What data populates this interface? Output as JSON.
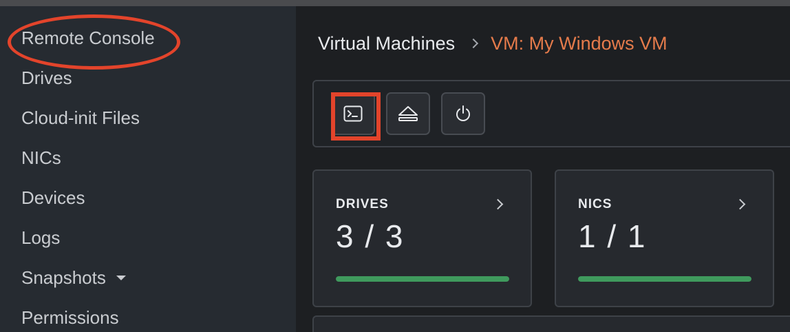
{
  "sidebar": {
    "items": [
      {
        "label": "Remote Console"
      },
      {
        "label": "Drives"
      },
      {
        "label": "Cloud-init Files"
      },
      {
        "label": "NICs"
      },
      {
        "label": "Devices"
      },
      {
        "label": "Logs"
      },
      {
        "label": "Snapshots"
      },
      {
        "label": "Permissions"
      }
    ]
  },
  "breadcrumb": {
    "root": "Virtual Machines",
    "current": "VM: My Windows VM"
  },
  "toolbar": {
    "buttons": [
      {
        "icon": "terminal-icon"
      },
      {
        "icon": "eject-icon"
      },
      {
        "icon": "power-icon"
      }
    ]
  },
  "cards": [
    {
      "label": "DRIVES",
      "value": "3 / 3",
      "progress": 1.0
    },
    {
      "label": "NICS",
      "value": "1 / 1",
      "progress": 1.0
    }
  ],
  "colors": {
    "accent_orange": "#e57b4b",
    "annotation_red": "#e3442b",
    "progress_green": "#3f9a5d"
  }
}
